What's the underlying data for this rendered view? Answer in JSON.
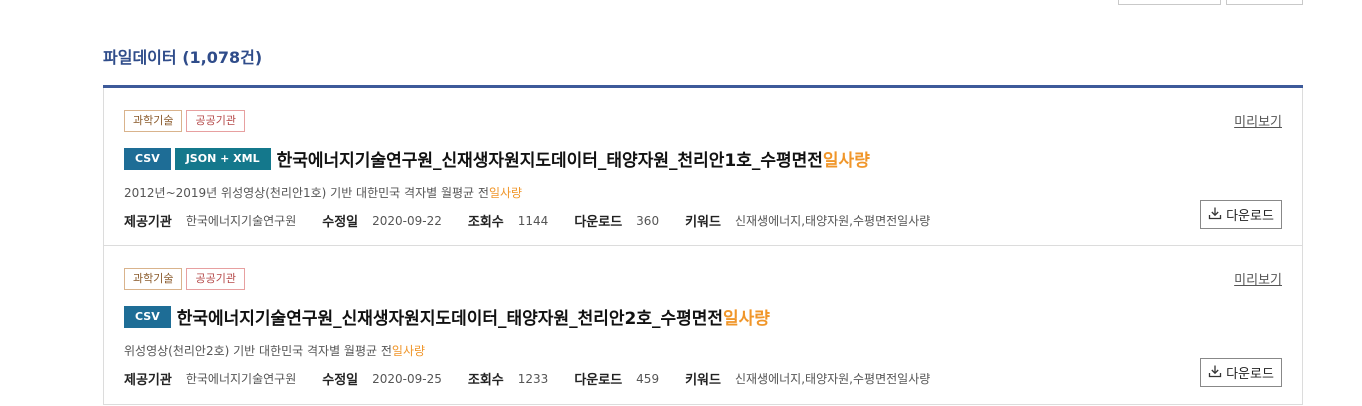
{
  "section": {
    "title": "파일데이터",
    "count": "(1,078건)"
  },
  "items": [
    {
      "tags": [
        "과학기술",
        "공공기관"
      ],
      "formats": [
        "CSV",
        "JSON + XML"
      ],
      "title_main": "한국에너지기술연구원_신재생자원지도데이터_태양자원_천리안1호_수평면전",
      "title_hl": "일사량",
      "desc_main": "2012년~2019년 위성영상(천리안1호) 기반 대한민국 격자별 월평균 전",
      "desc_hl": "일사량",
      "preview": "미리보기",
      "meta": {
        "provider_label": "제공기관",
        "provider": "한국에너지기술연구원",
        "modified_label": "수정일",
        "modified": "2020-09-22",
        "views_label": "조회수",
        "views": "1144",
        "downloads_label": "다운로드",
        "downloads": "360",
        "keywords_label": "키워드",
        "keywords": "신재생에너지,태양자원,수평면전일사량"
      },
      "download_button": "다운로드"
    },
    {
      "tags": [
        "과학기술",
        "공공기관"
      ],
      "formats": [
        "CSV"
      ],
      "title_main": "한국에너지기술연구원_신재생자원지도데이터_태양자원_천리안2호_수평면전",
      "title_hl": "일사량",
      "desc_main": "위성영상(천리안2호) 기반 대한민국 격자별 월평균 전",
      "desc_hl": "일사량",
      "preview": "미리보기",
      "meta": {
        "provider_label": "제공기관",
        "provider": "한국에너지기술연구원",
        "modified_label": "수정일",
        "modified": "2020-09-25",
        "views_label": "조회수",
        "views": "1233",
        "downloads_label": "다운로드",
        "downloads": "459",
        "keywords_label": "키워드",
        "keywords": "신재생에너지,태양자원,수평면전일사량"
      },
      "download_button": "다운로드"
    }
  ]
}
